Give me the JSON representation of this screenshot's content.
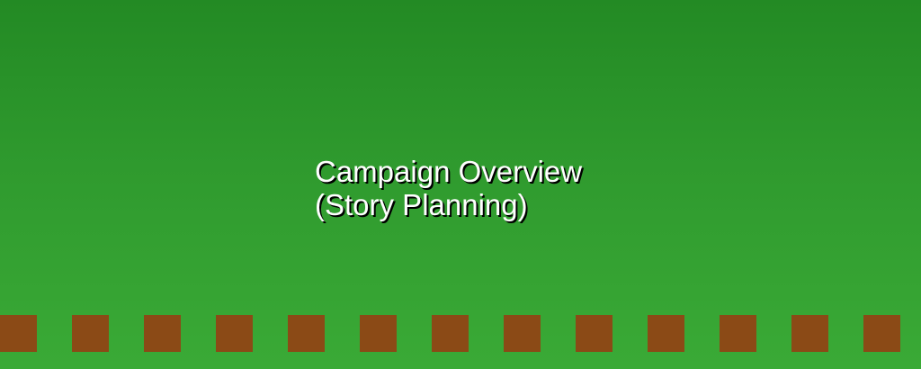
{
  "scene": {
    "title_line1": "Campaign Overview",
    "title_line2": "(Story Planning)"
  },
  "colors": {
    "sky_top": "#238a24",
    "sky_bottom": "#3aaa36",
    "ground_block": "#8b4a16",
    "title_text": "#ffffff"
  },
  "ground": {
    "block_count": 13
  }
}
